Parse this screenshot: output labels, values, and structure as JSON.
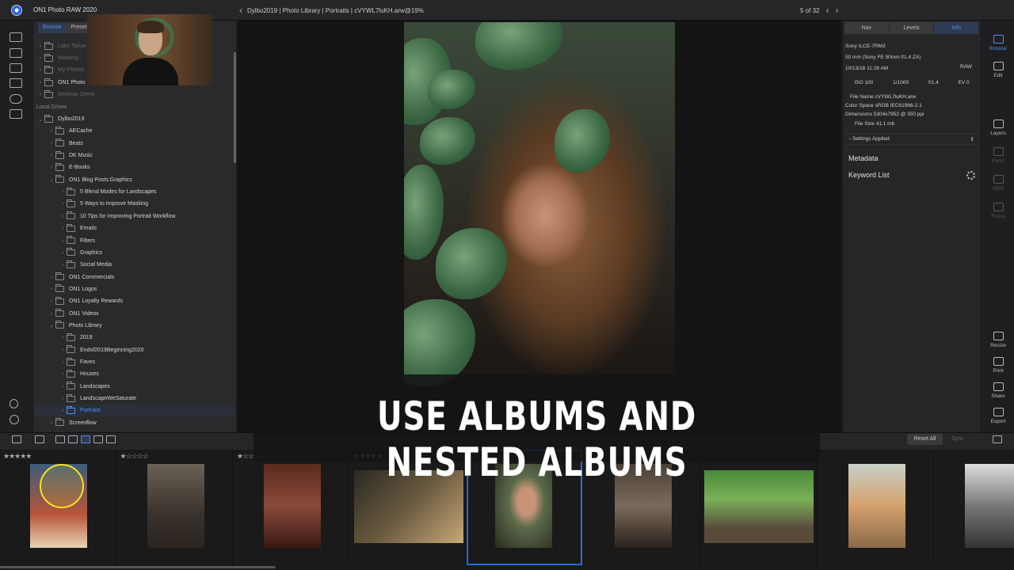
{
  "app": {
    "title": "ON1 Photo RAW 2020"
  },
  "pathbar": {
    "text": "Dylbo2019 | Photo Library | Portraits | cVYWL7luKH.arw@19%"
  },
  "counter": {
    "text": "5 of 32"
  },
  "browser_tabs": [
    "Browse",
    "Presets"
  ],
  "recent_items": [
    "Lake Tahoe",
    "Masking",
    "My Photos",
    "ON1 Photo",
    "Webinar Demo"
  ],
  "local_drives_label": "Local Drives",
  "tree": [
    {
      "label": "Dylbo2019",
      "depth": 0,
      "open": true
    },
    {
      "label": "AECache",
      "depth": 1
    },
    {
      "label": "Beats",
      "depth": 1
    },
    {
      "label": "DK Music",
      "depth": 1
    },
    {
      "label": "E-Books",
      "depth": 1
    },
    {
      "label": "ON1 Blog Posts:Graphics",
      "depth": 1,
      "open": true
    },
    {
      "label": "5 Blend Modes for Landscapes",
      "depth": 2
    },
    {
      "label": "5 Ways to Improve Masking",
      "depth": 2
    },
    {
      "label": "10 Tips for Improving Portrait Workflow",
      "depth": 2
    },
    {
      "label": "Emails",
      "depth": 2
    },
    {
      "label": "Filters",
      "depth": 2
    },
    {
      "label": "Graphics",
      "depth": 2
    },
    {
      "label": "Social Media",
      "depth": 2
    },
    {
      "label": "ON1 Commercials",
      "depth": 1
    },
    {
      "label": "ON1 Logos",
      "depth": 1
    },
    {
      "label": "ON1 Loyalty Rewards",
      "depth": 1
    },
    {
      "label": "ON1 Videos",
      "depth": 1
    },
    {
      "label": "Photo Library",
      "depth": 1,
      "open": true
    },
    {
      "label": "2019",
      "depth": 2
    },
    {
      "label": "Endof2019Beginning2020",
      "depth": 2
    },
    {
      "label": "Faves",
      "depth": 2
    },
    {
      "label": "Houses",
      "depth": 2
    },
    {
      "label": "Landscapes",
      "depth": 2
    },
    {
      "label": "LandscapeWeSaturate",
      "depth": 2
    },
    {
      "label": "Portraits",
      "depth": 2,
      "selected": true
    },
    {
      "label": "Screenflow",
      "depth": 1
    }
  ],
  "info_tabs": [
    "Nav",
    "Levels",
    "Info"
  ],
  "info": {
    "camera": "Sony ILCE-7RM3",
    "lens": "50 mm (Sony FE 50mm f/1.4 ZA)",
    "date": "10/13/18 11:28 AM",
    "format": "RAW",
    "iso": "ISO 100",
    "shutter": "1/1000",
    "aperture": "f/1.4",
    "ev": "EV 0",
    "file_name": "File Name cVYWL7luKH.arw",
    "color_space": "Color Space sRGB IEC61966-2.1",
    "dimensions": "Dimensions 5304x7952 @ 350 ppi",
    "file_size": "File Size 41.1 mb",
    "settings_applied": "Settings Applied",
    "metadata": "Metadata",
    "keyword_list": "Keyword List"
  },
  "tools_top": [
    "Browse",
    "Edit",
    "Layers",
    "Pano",
    "HDR",
    "Focus"
  ],
  "tools_bottom": [
    "Resize",
    "Print",
    "Share",
    "Export"
  ],
  "bottom_bar": {
    "reset_all": "Reset All",
    "sync": "Sync"
  },
  "filmstrip": [
    {
      "stars": "★★★★★"
    },
    {
      "stars": "★☆☆☆☆"
    },
    {
      "stars": "★☆☆☆☆"
    },
    {
      "stars": "★★★★★"
    },
    {
      "stars": ""
    },
    {
      "stars": ""
    },
    {
      "stars": ""
    },
    {
      "stars": ""
    },
    {
      "stars": ""
    }
  ],
  "caption": "USE ALBUMS AND NESTED ALBUMS",
  "colors": {
    "accent": "#4d8ef5",
    "selection": "#2a6ad8",
    "cursor_highlight": "#f3e324"
  }
}
